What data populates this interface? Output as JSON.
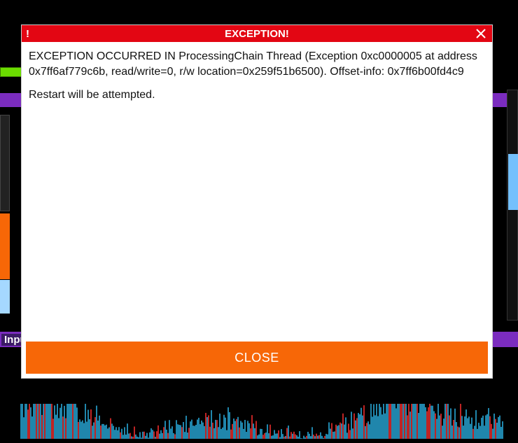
{
  "background": {
    "input_label": "Inpu"
  },
  "dialog": {
    "bang": "!",
    "title": "EXCEPTION!",
    "message_main": "EXCEPTION OCCURRED IN ProcessingChain Thread (Exception 0xc0000005 at address 0x7ff6af779c6b, read/write=0, r/w location=0x259f51b6500). Offset-info: 0x7ff6b00fd4c9",
    "message_sub": "Restart will be attempted.",
    "close_label": "CLOSE"
  }
}
